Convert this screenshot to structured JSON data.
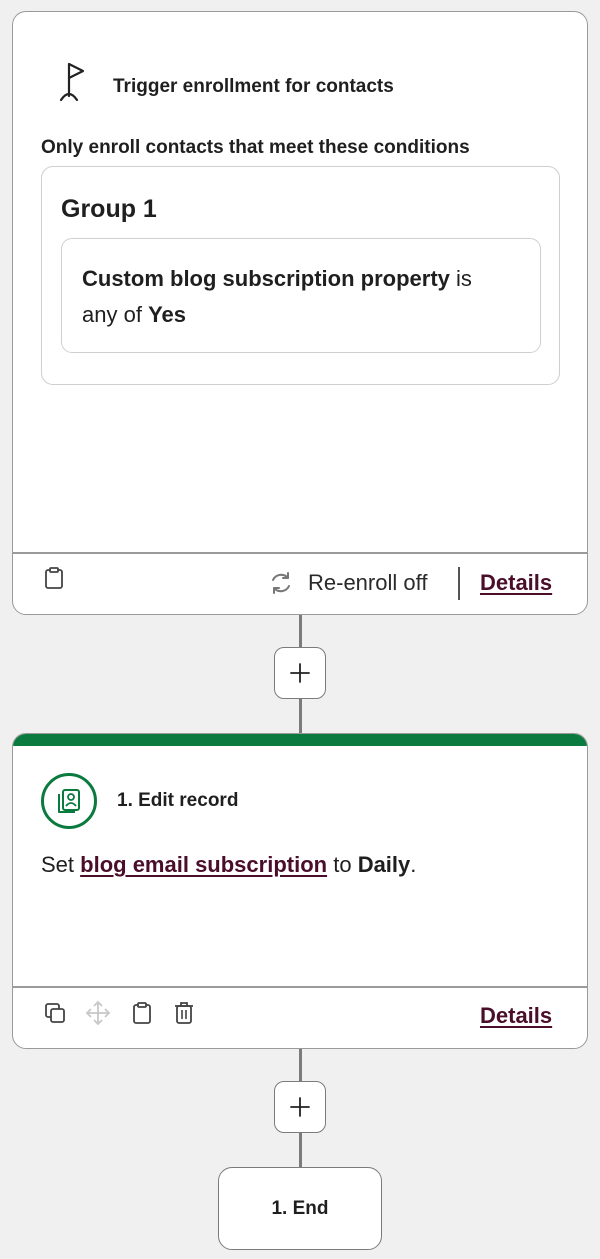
{
  "trigger": {
    "title": "Trigger enrollment for contacts",
    "subtitle": "Only enroll contacts that meet these conditions",
    "group": {
      "title": "Group 1",
      "condition": {
        "property": "Custom blog subscription property",
        "operator_part1": "is",
        "operator_part2": "any of",
        "value": "Yes"
      }
    },
    "footer": {
      "reenroll_label": "Re-enroll off",
      "details_label": "Details"
    }
  },
  "action": {
    "title": "1. Edit record",
    "body": {
      "prefix": "Set",
      "property_link": "blog email subscription",
      "middle": "to",
      "value": "Daily",
      "suffix": "."
    },
    "footer": {
      "details_label": "Details"
    }
  },
  "end": {
    "label": "1. End"
  },
  "colors": {
    "accent_green": "#0b7a3e",
    "link_color": "#4a0d2a",
    "background": "#f0f0f0"
  },
  "icons": [
    "flag-icon",
    "clipboard-icon",
    "refresh-icon",
    "plus-icon",
    "edit-record-icon",
    "copy-icon",
    "move-icon",
    "trash-icon"
  ]
}
